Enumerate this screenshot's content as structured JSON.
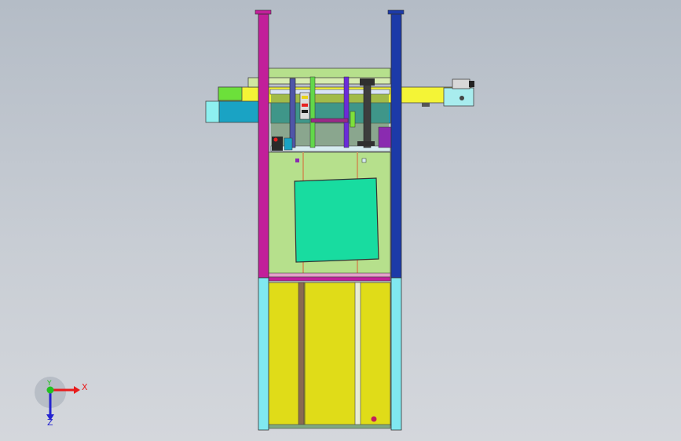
{
  "triad": {
    "x_label": "X",
    "y_label": "Y",
    "z_label": "Z"
  },
  "colors": {
    "background_top": "#b4bcc6",
    "background_bottom": "#d4d7dc",
    "left_column": "#c21f9a",
    "right_column": "#1c3aa8",
    "column_base": "#80e8f0",
    "upper_cabinet": "#b6e08c",
    "window_panel": "#18dca0",
    "lower_cabinet": "#e0dc18",
    "beam": "#f4f436",
    "blue_block": "#1aa3c4",
    "x_axis": "#e81b1b",
    "y_axis": "#22c020",
    "z_axis": "#2424d0"
  }
}
